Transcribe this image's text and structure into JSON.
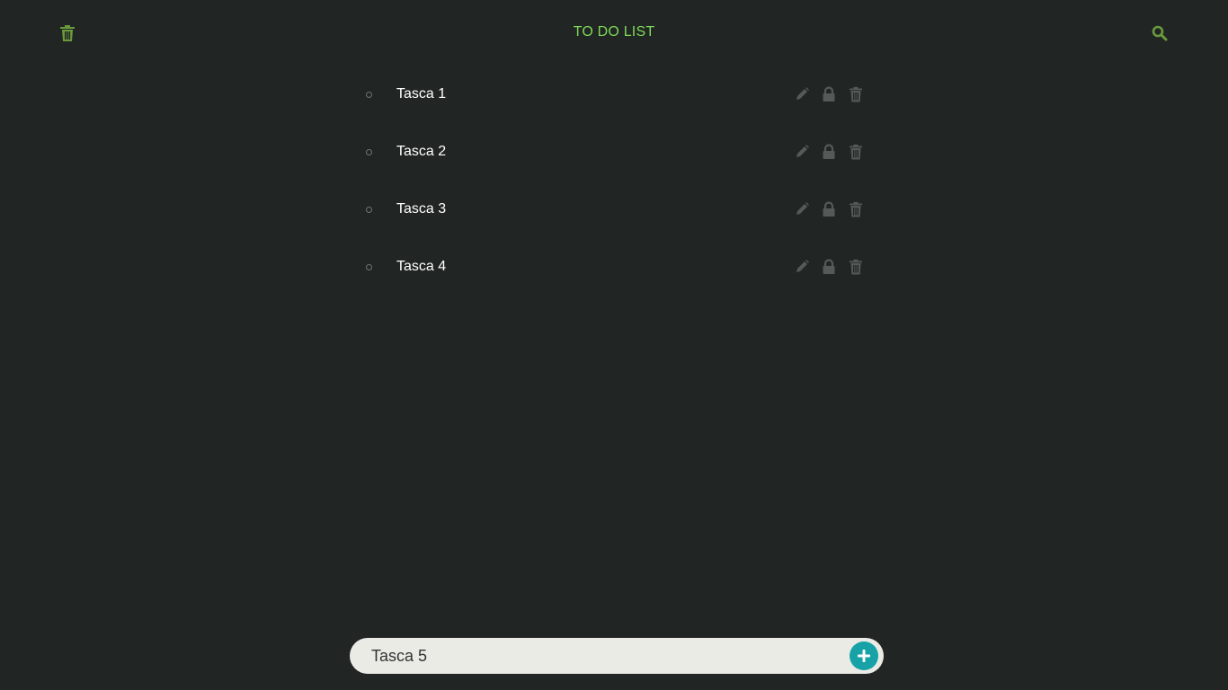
{
  "header": {
    "title": "TO DO LIST",
    "trash_icon": "trash-icon",
    "search_icon": "search-icon"
  },
  "tasks": [
    {
      "label": "Tasca 1"
    },
    {
      "label": "Tasca 2"
    },
    {
      "label": "Tasca 3"
    },
    {
      "label": "Tasca 4"
    }
  ],
  "task_action_icons": [
    "pencil-icon",
    "lock-icon",
    "trash-icon"
  ],
  "add_bar": {
    "value": "Tasca 5",
    "button_icon": "plus-icon"
  },
  "colors": {
    "background": "#212524",
    "accent_title": "#7ed957",
    "header_icons": "#6a9a3c",
    "task_icons": "#555958",
    "add_bar_bg": "#ebebe6",
    "add_button": "#16a2a6"
  }
}
